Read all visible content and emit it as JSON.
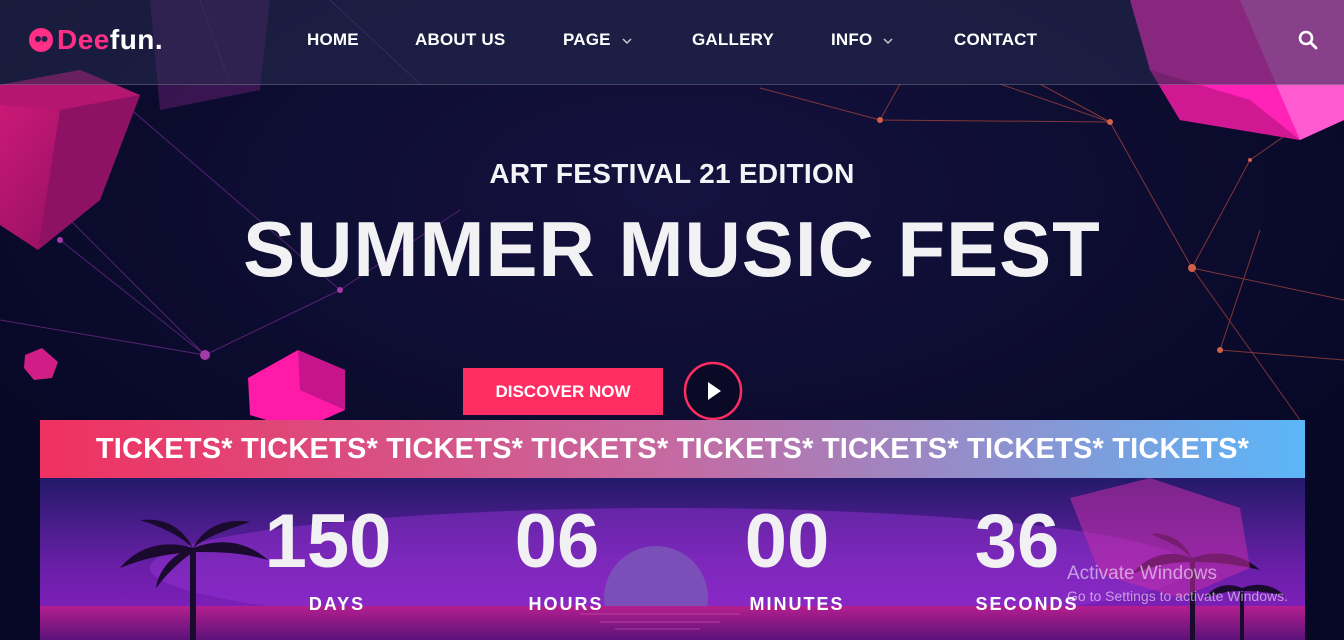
{
  "brand": {
    "logo_prefix": "Dee",
    "logo_suffix": "fun."
  },
  "nav": {
    "home": "HOME",
    "about": "ABOUT US",
    "page": "PAGE",
    "gallery": "GALLERY",
    "info": "INFO",
    "contact": "CONTACT"
  },
  "hero": {
    "subtitle": "ART FESTIVAL 21 EDITION",
    "title": "SUMMER MUSIC FEST",
    "cta": "DISCOVER NOW"
  },
  "banner": {
    "text": "TICKETS* TICKETS* TICKETS* TICKETS* TICKETS* TICKETS* TICKETS* TICKETS*"
  },
  "countdown": {
    "days": "150",
    "days_label": "DAYS",
    "hours": "06",
    "hours_label": "HOURS",
    "minutes": "00",
    "minutes_label": "MINUTES",
    "seconds": "36",
    "seconds_label": "SECONDS"
  },
  "watermark": {
    "line1": "Activate Windows",
    "line2": "Go to Settings to activate Windows."
  },
  "colors": {
    "accent": "#ff2d62",
    "background": "#080a2c",
    "logo_pink": "#ff2f86",
    "banner_start": "#f0315f",
    "banner_end": "#5bb6f8"
  },
  "icons": [
    "logo-icon",
    "chevron-down-icon",
    "search-icon",
    "play-icon"
  ]
}
